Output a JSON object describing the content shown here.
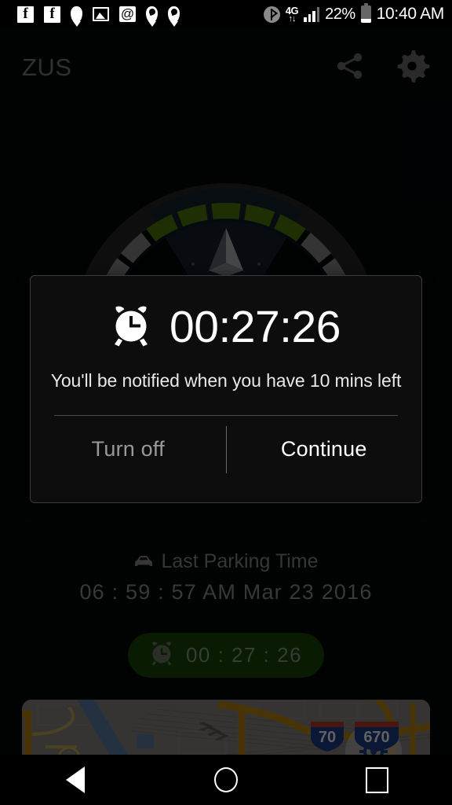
{
  "status_bar": {
    "left_icons": [
      {
        "name": "facebook-icon"
      },
      {
        "name": "facebook-icon"
      },
      {
        "name": "location-pin-icon"
      },
      {
        "name": "gallery-image-icon"
      },
      {
        "name": "email-at-icon"
      },
      {
        "name": "periscope-pin-icon"
      },
      {
        "name": "periscope-pin-icon"
      }
    ],
    "bluetooth_icon": "bluetooth-icon",
    "network_type": "4G",
    "network_arrows": "↑↓",
    "signal_icon": "signal-bars-icon",
    "battery_percent": "22%",
    "battery_icon": "battery-icon",
    "clock": "10:40 AM"
  },
  "header": {
    "title": "ZUS",
    "share_icon": "share-icon",
    "settings_icon": "gear-icon"
  },
  "gauge": {
    "green_color": "#4f7d0c",
    "gray_color": "#8a8a8a",
    "track_color": "#2a2a2a",
    "cone_color": "#16222f",
    "pointer_color": "#8f9499",
    "segment_count": 24,
    "green_segments": 5
  },
  "dialog": {
    "alarm_icon": "alarm-clock-icon",
    "time": "00:27:26",
    "message": "You'll be notified when you have 10 mins left",
    "turn_off_label": "Turn off",
    "continue_label": "Continue"
  },
  "parking": {
    "car_icon": "car-icon",
    "label": "Last Parking Time",
    "time": "06 : 59 : 57  AM  Mar  23  2016"
  },
  "timer_pill": {
    "alarm_icon": "alarm-clock-icon",
    "time": "00 : 27 : 26",
    "background_color": "#1b4708",
    "text_color": "#8e9b86"
  },
  "map": {
    "shield_labels": [
      "70",
      "670"
    ],
    "shield_top_color": "#c0392b",
    "shield_body_color": "#1b3f8f",
    "highway_color": "#c08a16",
    "water_color": "#5a7fb0",
    "land_color": "#8d8a86",
    "marker_icon": "location-marker-icon"
  },
  "nav_bar": {
    "back_icon": "back-triangle-icon",
    "home_icon": "home-circle-icon",
    "recents_icon": "recents-square-icon"
  }
}
